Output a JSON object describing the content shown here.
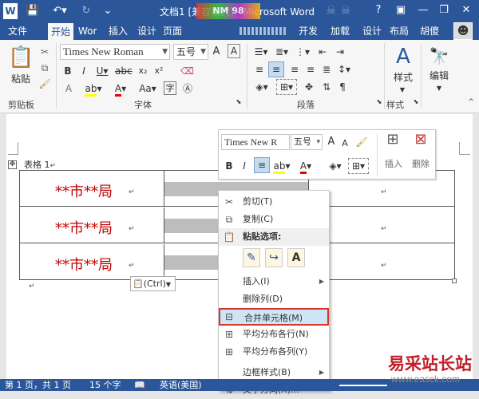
{
  "window": {
    "title": "文档1 [兼容模式] - Microsoft Word",
    "overlay_badge": "NM 98",
    "help": "?",
    "minimize": "—",
    "restore": "❐",
    "close": "✕",
    "user": "胡傻"
  },
  "tabs": [
    "文件",
    "开始",
    "Wor",
    "插入",
    "设计",
    "页面",
    "开发",
    "加载",
    "设计",
    "布局"
  ],
  "ribbon": {
    "paste_label": "粘贴",
    "font_name": "Times New Roman",
    "font_size": "五号",
    "groups": [
      "剪贴板",
      "字体",
      "段落",
      "样式"
    ],
    "styles_label": "样式",
    "edit_label": "编辑"
  },
  "doc": {
    "table_label": "表格 1",
    "return_mark": "↵",
    "rows": [
      "**市**局",
      "**市**局",
      "**市**局"
    ],
    "paste_options_button": "(Ctrl)"
  },
  "mini_toolbar": {
    "font_name": "Times New R",
    "font_size": "五号",
    "insert_label": "插入",
    "delete_label": "删除"
  },
  "context_menu": {
    "items": [
      "剪切(T)",
      "复制(C)",
      "粘贴选项:",
      "插入(I)",
      "删除列(D)",
      "合并单元格(M)",
      "平均分布各行(N)",
      "平均分布各列(Y)",
      "边框样式(B)",
      "文字方向(X)..."
    ],
    "highlighted": "合并单元格(M)"
  },
  "status": {
    "page": "第 1 页，共 1 页",
    "words": "15 个字",
    "language": "英语(美国)"
  },
  "watermark": {
    "title": "易采站长站",
    "url": "www.easck.com"
  },
  "colors": {
    "brand": "#2b579a",
    "bureau_text": "#c00000",
    "highlight_border": "#d9352a"
  }
}
